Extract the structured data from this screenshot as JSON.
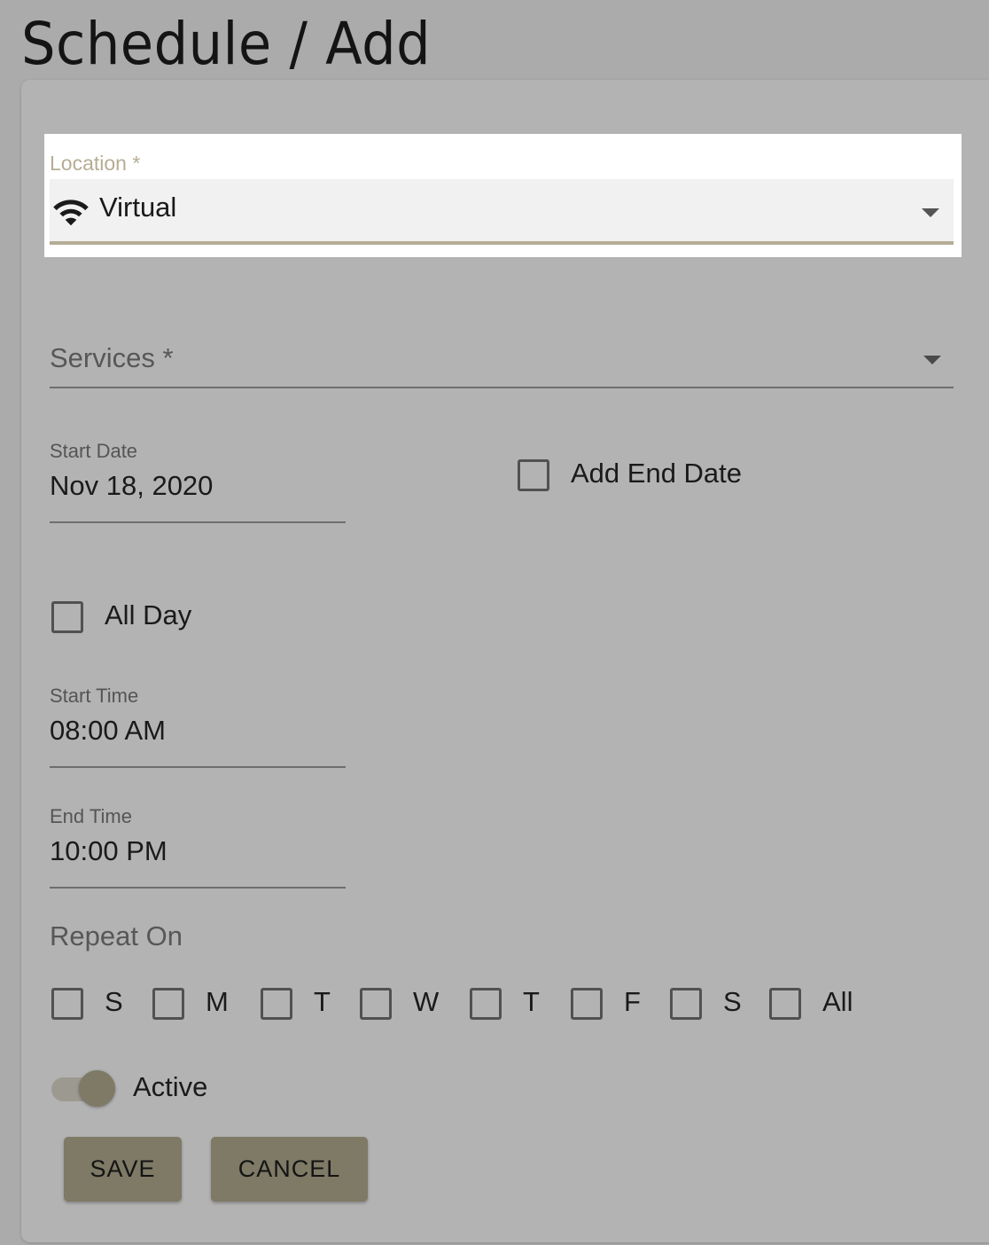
{
  "page": {
    "title": "Schedule / Add"
  },
  "form": {
    "location": {
      "label": "Location *",
      "value": "Virtual",
      "icon": "wifi-icon"
    },
    "services": {
      "label": "Services *",
      "value": ""
    },
    "start_date": {
      "label": "Start Date",
      "value": "Nov 18, 2020"
    },
    "add_end_date": {
      "label": "Add End Date",
      "checked": false
    },
    "all_day": {
      "label": "All Day",
      "checked": false
    },
    "start_time": {
      "label": "Start Time",
      "value": "08:00 AM"
    },
    "end_time": {
      "label": "End Time",
      "value": "10:00 PM"
    },
    "repeat_on": {
      "label": "Repeat On",
      "days": [
        {
          "label": "S",
          "checked": false
        },
        {
          "label": "M",
          "checked": false
        },
        {
          "label": "T",
          "checked": false
        },
        {
          "label": "W",
          "checked": false
        },
        {
          "label": "T",
          "checked": false
        },
        {
          "label": "F",
          "checked": false
        },
        {
          "label": "S",
          "checked": false
        },
        {
          "label": "All",
          "checked": false
        }
      ]
    },
    "active": {
      "label": "Active",
      "on": true
    }
  },
  "actions": {
    "save_label": "SAVE",
    "cancel_label": "CANCEL"
  },
  "colors": {
    "accent": "#b5ad94",
    "button": "#7e7a66",
    "overlay": "#ababab"
  }
}
